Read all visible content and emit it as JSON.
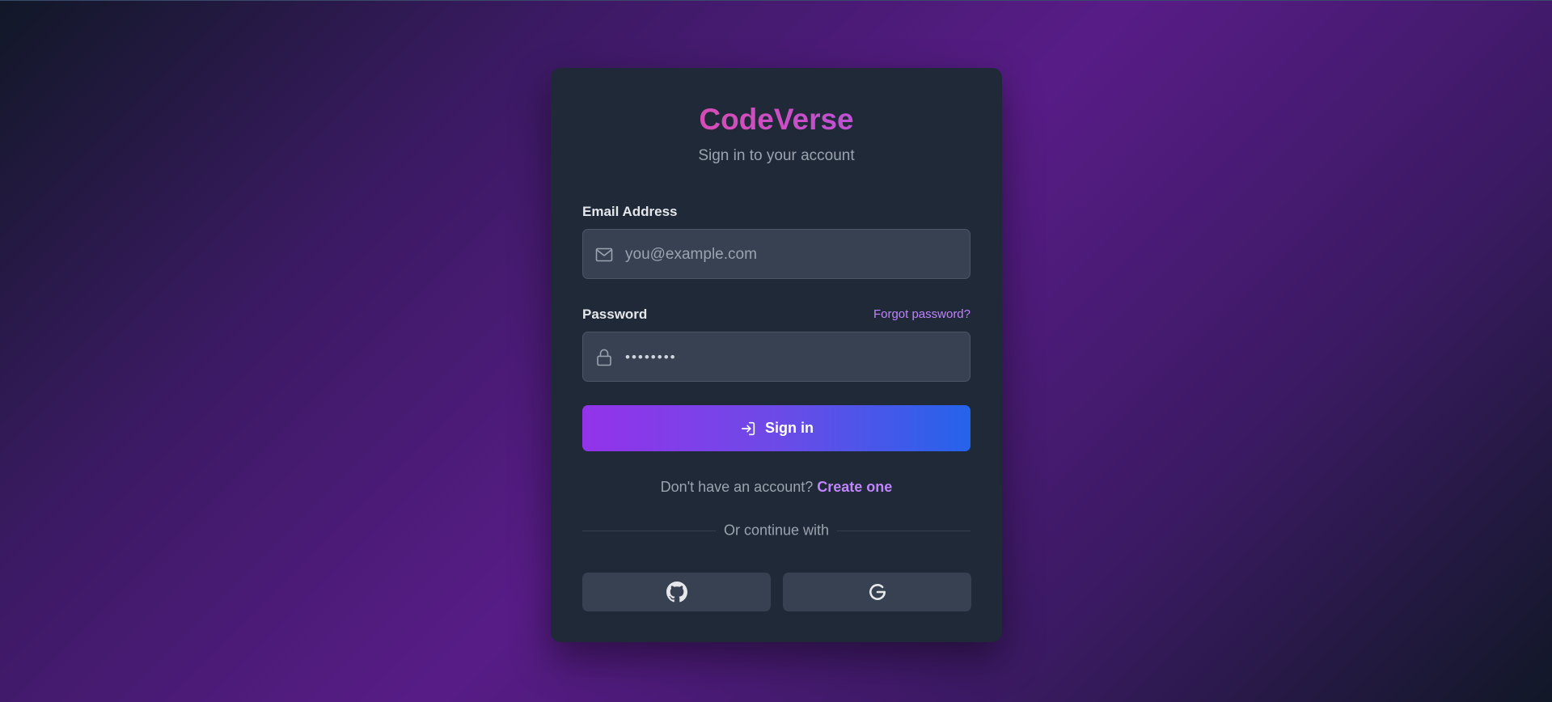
{
  "brand": {
    "name": "CodeVerse",
    "subtitle": "Sign in to your account"
  },
  "form": {
    "email_label": "Email Address",
    "email_placeholder": "you@example.com",
    "email_value": "",
    "email_icon": "mail-icon",
    "password_label": "Password",
    "forgot_link": "Forgot password?",
    "password_value": "••••••••",
    "password_icon": "lock-icon",
    "submit_label": "Sign in",
    "submit_icon": "login-icon"
  },
  "signup": {
    "prompt": "Don't have an account?",
    "link": "Create one"
  },
  "social": {
    "divider_text": "Or continue with",
    "providers": [
      {
        "name": "github",
        "icon": "github-icon"
      },
      {
        "name": "google",
        "icon": "google-icon"
      }
    ]
  },
  "colors": {
    "card_bg": "#1f2937",
    "input_bg": "#374151",
    "accent_purple": "#c084fc",
    "button_gradient_start": "#9333ea",
    "button_gradient_end": "#2563eb",
    "brand_gradient_start": "#ec4899",
    "brand_gradient_end": "#a855f7"
  }
}
